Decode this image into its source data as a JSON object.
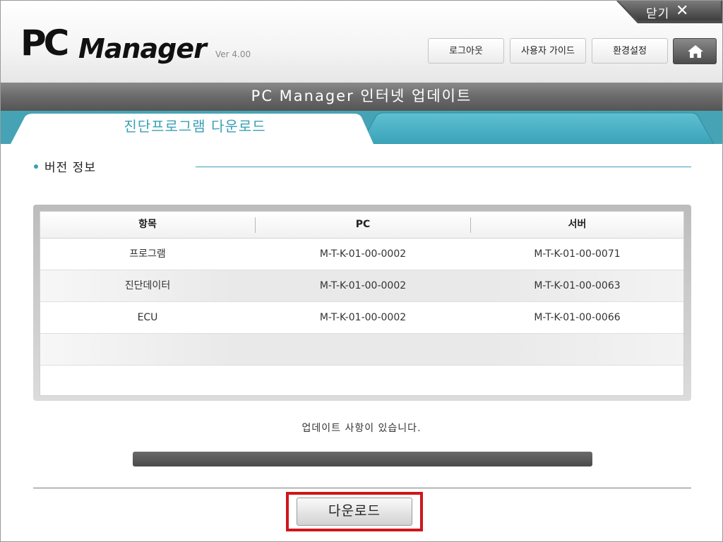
{
  "window": {
    "close_label": "닫기",
    "close_icon": "close-x-icon"
  },
  "brand": {
    "logo_pc": "PC",
    "logo_manager": "Manager",
    "version": "Ver 4.00"
  },
  "header_buttons": {
    "logout": "로그아웃",
    "user_guide": "사용자 가이드",
    "settings": "환경설정",
    "home_icon": "home-icon"
  },
  "title": "PC Manager 인터넷 업데이트",
  "tabs": {
    "active_label": "진단프로그램 다운로드"
  },
  "section": {
    "title": "버전 정보"
  },
  "table": {
    "headers": [
      "항목",
      "PC",
      "서버"
    ],
    "rows": [
      {
        "item": "프로그램",
        "pc": "M-T-K-01-00-0002",
        "server": "M-T-K-01-00-0071"
      },
      {
        "item": "진단데이터",
        "pc": "M-T-K-01-00-0002",
        "server": "M-T-K-01-00-0063"
      },
      {
        "item": "ECU",
        "pc": "M-T-K-01-00-0002",
        "server": "M-T-K-01-00-0066"
      }
    ]
  },
  "status_text": "업데이트 사항이 있습니다.",
  "progress": 0,
  "download_button": "다운로드",
  "colors": {
    "accent": "#3a9fb5",
    "tab_strip": "#45a3b5",
    "highlight": "#d0161a"
  }
}
